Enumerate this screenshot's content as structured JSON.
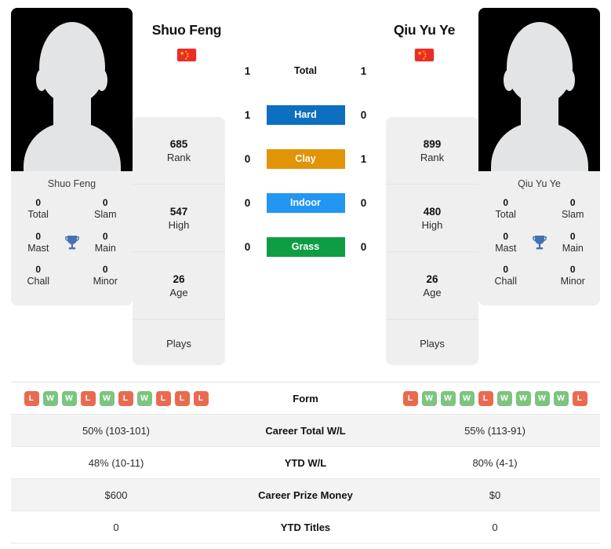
{
  "players": {
    "left": {
      "name": "Shuo Feng",
      "photo_caption": "Shuo Feng",
      "flag": "cn-flag-icon",
      "titles": [
        {
          "value": "0",
          "label": "Total"
        },
        {
          "value": "0",
          "label": "Slam"
        },
        {
          "value": "0",
          "label": "Mast"
        },
        {
          "value": "0",
          "label": "Main"
        },
        {
          "value": "0",
          "label": "Chall"
        },
        {
          "value": "0",
          "label": "Minor"
        }
      ],
      "stats": [
        {
          "value": "685",
          "label": "Rank"
        },
        {
          "value": "547",
          "label": "High"
        },
        {
          "value": "26",
          "label": "Age"
        },
        {
          "value": "",
          "label": "Plays"
        }
      ],
      "form": [
        "L",
        "W",
        "W",
        "L",
        "W",
        "L",
        "W",
        "L",
        "L",
        "L"
      ],
      "career_total_wl": "50% (103-101)",
      "ytd_wl": "48% (10-11)",
      "career_prize_money": "$600",
      "ytd_titles": "0"
    },
    "right": {
      "name": "Qiu Yu Ye",
      "photo_caption": "Qiu Yu Ye",
      "flag": "cn-flag-icon",
      "titles": [
        {
          "value": "0",
          "label": "Total"
        },
        {
          "value": "0",
          "label": "Slam"
        },
        {
          "value": "0",
          "label": "Mast"
        },
        {
          "value": "0",
          "label": "Main"
        },
        {
          "value": "0",
          "label": "Chall"
        },
        {
          "value": "0",
          "label": "Minor"
        }
      ],
      "stats": [
        {
          "value": "899",
          "label": "Rank"
        },
        {
          "value": "480",
          "label": "High"
        },
        {
          "value": "26",
          "label": "Age"
        },
        {
          "value": "",
          "label": "Plays"
        }
      ],
      "form": [
        "L",
        "W",
        "W",
        "W",
        "L",
        "W",
        "W",
        "W",
        "W",
        "L"
      ],
      "career_total_wl": "55% (113-91)",
      "ytd_wl": "80% (4-1)",
      "career_prize_money": "$0",
      "ytd_titles": "0"
    }
  },
  "h2h": [
    {
      "label": "Total",
      "left": "1",
      "right": "1",
      "color": ""
    },
    {
      "label": "Hard",
      "left": "1",
      "right": "0",
      "color": "#0d6fbf"
    },
    {
      "label": "Clay",
      "left": "0",
      "right": "1",
      "color": "#e09406"
    },
    {
      "label": "Indoor",
      "left": "0",
      "right": "0",
      "color": "#2196f3"
    },
    {
      "label": "Grass",
      "left": "0",
      "right": "0",
      "color": "#0f9d44"
    }
  ],
  "table": {
    "rows": [
      {
        "label": "Form",
        "type": "form"
      },
      {
        "label": "Career Total W/L",
        "type": "text",
        "key": "career_total_wl"
      },
      {
        "label": "YTD W/L",
        "type": "text",
        "key": "ytd_wl"
      },
      {
        "label": "Career Prize Money",
        "type": "text",
        "key": "career_prize_money"
      },
      {
        "label": "YTD Titles",
        "type": "text",
        "key": "ytd_titles"
      }
    ]
  },
  "colors": {
    "hard": "#0d6fbf",
    "clay": "#e09406",
    "indoor": "#2196f3",
    "grass": "#0f9d44",
    "win": "#7cc47f",
    "loss": "#ea6a4f",
    "trophy": "#4472b0",
    "card_bg": "#efefef",
    "flag_red": "#ee2b28",
    "flag_yellow": "#ffde00"
  }
}
